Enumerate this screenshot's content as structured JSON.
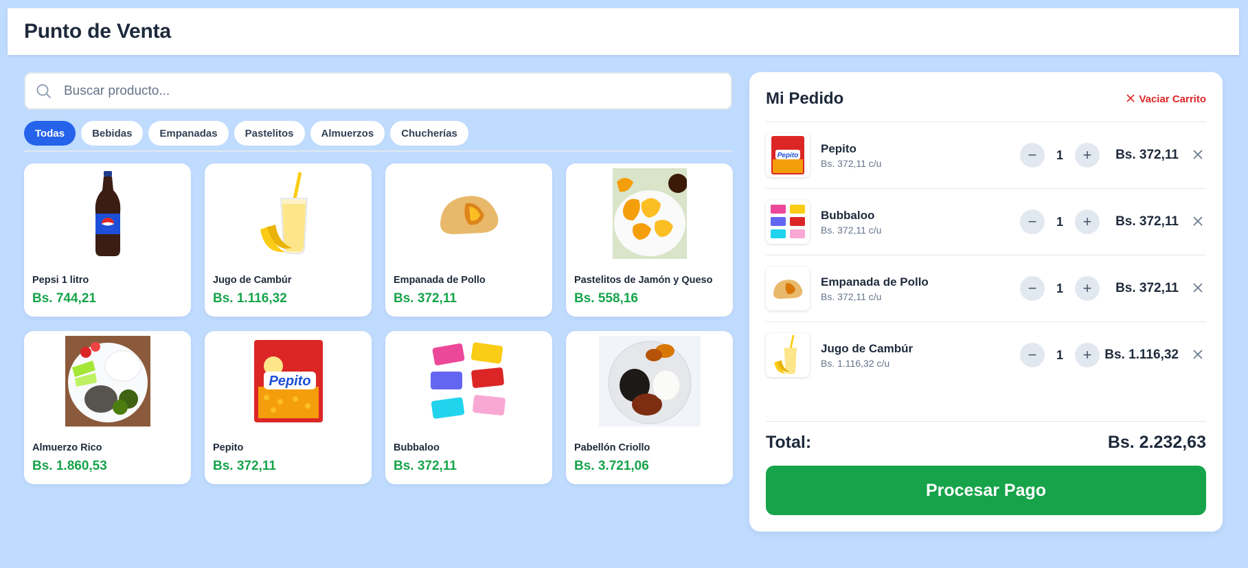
{
  "header": {
    "title": "Punto de Venta"
  },
  "search": {
    "placeholder": "Buscar producto..."
  },
  "categories": [
    {
      "label": "Todas",
      "active": true
    },
    {
      "label": "Bebidas",
      "active": false
    },
    {
      "label": "Empanadas",
      "active": false
    },
    {
      "label": "Pastelitos",
      "active": false
    },
    {
      "label": "Almuerzos",
      "active": false
    },
    {
      "label": "Chucherías",
      "active": false
    }
  ],
  "products": [
    {
      "name": "Pepsi 1 litro",
      "price": "Bs. 744,21",
      "icon": "soda-bottle-icon"
    },
    {
      "name": "Jugo de Cambúr",
      "price": "Bs. 1.116,32",
      "icon": "banana-juice-icon"
    },
    {
      "name": "Empanada de Pollo",
      "price": "Bs. 372,11",
      "icon": "empanada-icon"
    },
    {
      "name": "Pastelitos de Jamón y Queso",
      "price": "Bs. 558,16",
      "icon": "pastelitos-icon"
    },
    {
      "name": "Almuerzo Rico",
      "price": "Bs. 1.860,53",
      "icon": "lunch-plate-icon"
    },
    {
      "name": "Pepito",
      "price": "Bs. 372,11",
      "icon": "snack-bag-icon"
    },
    {
      "name": "Bubbaloo",
      "price": "Bs. 372,11",
      "icon": "candy-icon"
    },
    {
      "name": "Pabellón Criollo",
      "price": "Bs. 3.721,06",
      "icon": "pabellon-plate-icon"
    }
  ],
  "cart": {
    "title": "Mi Pedido",
    "clear_label": "Vaciar Carrito",
    "items": [
      {
        "name": "Pepito",
        "unit": "Bs. 372,11 c/u",
        "qty": "1",
        "total": "Bs. 372,11",
        "icon": "snack-bag-icon"
      },
      {
        "name": "Bubbaloo",
        "unit": "Bs. 372,11 c/u",
        "qty": "1",
        "total": "Bs. 372,11",
        "icon": "candy-icon"
      },
      {
        "name": "Empanada de Pollo",
        "unit": "Bs. 372,11 c/u",
        "qty": "1",
        "total": "Bs. 372,11",
        "icon": "empanada-icon"
      },
      {
        "name": "Jugo de Cambúr",
        "unit": "Bs. 1.116,32 c/u",
        "qty": "1",
        "total": "Bs. 1.116,32",
        "icon": "banana-juice-icon"
      }
    ],
    "total_label": "Total:",
    "total_value": "Bs. 2.232,63",
    "pay_label": "Procesar Pago"
  },
  "colors": {
    "background": "#bfdbfe",
    "accent": "#2563eb",
    "price": "#16a34a",
    "pay_button": "#16a34a",
    "danger": "#dc2626"
  }
}
